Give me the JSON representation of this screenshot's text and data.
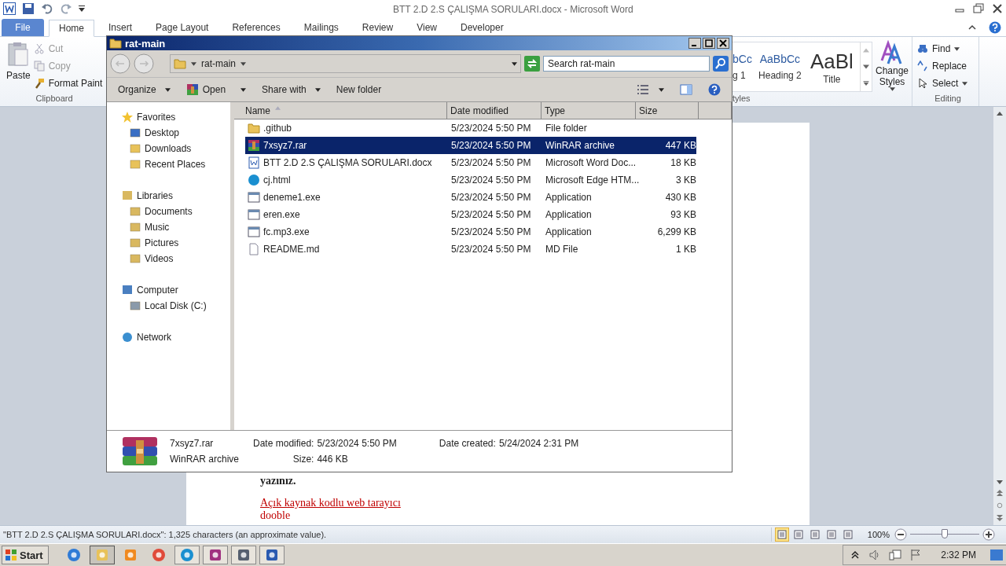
{
  "word": {
    "title": "BTT 2.D 2.S ÇALIŞMA SORULARI.docx - Microsoft Word",
    "tabs": [
      {
        "label": "File",
        "kind": "file",
        "selected": false
      },
      {
        "label": "Home",
        "kind": "tab",
        "selected": true
      },
      {
        "label": "Insert",
        "kind": "tab",
        "selected": false
      },
      {
        "label": "Page Layout",
        "kind": "tab",
        "selected": false
      },
      {
        "label": "References",
        "kind": "tab",
        "selected": false
      },
      {
        "label": "Mailings",
        "kind": "tab",
        "selected": false
      },
      {
        "label": "Review",
        "kind": "tab",
        "selected": false
      },
      {
        "label": "View",
        "kind": "tab",
        "selected": false
      },
      {
        "label": "Developer",
        "kind": "tab",
        "selected": false
      }
    ],
    "clipboard": {
      "paste": "Paste",
      "cut": "Cut",
      "copy": "Copy",
      "format_painter": "Format Paint",
      "label": "Clipboard"
    },
    "styles": {
      "items": [
        {
          "sample": "bCc",
          "name": "g 1",
          "kind": "heading1"
        },
        {
          "sample": "AaBbCc",
          "name": "Heading 2",
          "kind": "heading2"
        },
        {
          "sample": "AaBl",
          "name": "Title",
          "kind": "title"
        }
      ],
      "change": "Change Styles",
      "label": "tyles"
    },
    "editing": {
      "find": "Find",
      "replace": "Replace",
      "select": "Select",
      "label": "Editing"
    },
    "document": {
      "lines": [
        {
          "text": "yazınız.",
          "kind": "bold"
        },
        {
          "text": "Açık kaynak kodlu  web tarayıcı",
          "kind": "link"
        },
        {
          "text": "dooble",
          "kind": "answer"
        }
      ]
    },
    "status": {
      "text": "\"BTT 2.D 2.S ÇALIŞMA SORULARI.docx\": 1,325 characters (an approximate value).",
      "views": [
        {
          "selected": true
        },
        {
          "selected": false
        },
        {
          "selected": false
        },
        {
          "selected": false
        },
        {
          "selected": false
        }
      ],
      "zoom": "100%",
      "zoom_slider": {
        "level": 0.5
      }
    }
  },
  "explorer": {
    "title": "rat-main",
    "breadcrumb": "rat-main",
    "search": {
      "placeholder": "Search rat-main"
    },
    "toolbar": [
      {
        "label": "Organize",
        "kind": "menu"
      },
      {
        "label": "Open",
        "kind": "split"
      },
      {
        "label": "Share with",
        "kind": "menu"
      },
      {
        "label": "New folder",
        "kind": "plain"
      }
    ],
    "nav": [
      {
        "label": "Favorites",
        "kind": "star",
        "children": [
          {
            "label": "Desktop",
            "kind": "desktop"
          },
          {
            "label": "Downloads",
            "kind": "folder"
          },
          {
            "label": "Recent Places",
            "kind": "folder"
          }
        ]
      },
      {
        "label": "Libraries",
        "kind": "library",
        "children": [
          {
            "label": "Documents",
            "kind": "document"
          },
          {
            "label": "Music",
            "kind": "music"
          },
          {
            "label": "Pictures",
            "kind": "picture"
          },
          {
            "label": "Videos",
            "kind": "video"
          }
        ]
      },
      {
        "label": "Computer",
        "kind": "computer",
        "children": [
          {
            "label": "Local Disk (C:)",
            "kind": "disk"
          }
        ]
      },
      {
        "label": "Network",
        "kind": "network"
      }
    ],
    "columns": [
      "Name",
      "Date modified",
      "Type",
      "Size"
    ],
    "rows": [
      {
        "name": ".github",
        "date": "5/23/2024 5:50 PM",
        "type": "File folder",
        "size": "",
        "kind": "folder",
        "selected": false
      },
      {
        "name": "7xsyz7.rar",
        "date": "5/23/2024 5:50 PM",
        "type": "WinRAR archive",
        "size": "447 KB",
        "kind": "rar",
        "selected": true
      },
      {
        "name": "BTT 2.D 2.S ÇALIŞMA SORULARI.docx",
        "date": "5/23/2024 5:50 PM",
        "type": "Microsoft Word Doc...",
        "size": "18 KB",
        "kind": "word",
        "selected": false
      },
      {
        "name": "cj.html",
        "date": "5/23/2024 5:50 PM",
        "type": "Microsoft Edge HTM...",
        "size": "3 KB",
        "kind": "edge",
        "selected": false
      },
      {
        "name": "deneme1.exe",
        "date": "5/23/2024 5:50 PM",
        "type": "Application",
        "size": "430 KB",
        "kind": "exe",
        "selected": false
      },
      {
        "name": "eren.exe",
        "date": "5/23/2024 5:50 PM",
        "type": "Application",
        "size": "93 KB",
        "kind": "exe",
        "selected": false
      },
      {
        "name": "fc.mp3.exe",
        "date": "5/23/2024 5:50 PM",
        "type": "Application",
        "size": "6,299 KB",
        "kind": "exe",
        "selected": false
      },
      {
        "name": "README.md",
        "date": "5/23/2024 5:50 PM",
        "type": "MD File",
        "size": "1 KB",
        "kind": "file",
        "selected": false
      }
    ],
    "details": {
      "name": "7xsyz7.rar",
      "type": "WinRAR archive",
      "modified_label": "Date modified:",
      "modified": "5/23/2024 5:50 PM",
      "size_label": "Size:",
      "size": "446 KB",
      "created_label": "Date created:",
      "created": "5/24/2024 2:31 PM"
    }
  },
  "taskbar": {
    "start": "Start",
    "apps": [
      {
        "kind": "ie",
        "open": false,
        "selected": false
      },
      {
        "kind": "explorer",
        "open": true,
        "selected": true
      },
      {
        "kind": "media",
        "open": false,
        "selected": false
      },
      {
        "kind": "chrome",
        "open": false,
        "selected": false
      },
      {
        "kind": "edge",
        "open": true,
        "selected": false
      },
      {
        "kind": "winrar",
        "open": true,
        "selected": false
      },
      {
        "kind": "app",
        "open": true,
        "selected": false
      },
      {
        "kind": "word",
        "open": true,
        "selected": false
      }
    ],
    "time": "2:32 PM"
  }
}
